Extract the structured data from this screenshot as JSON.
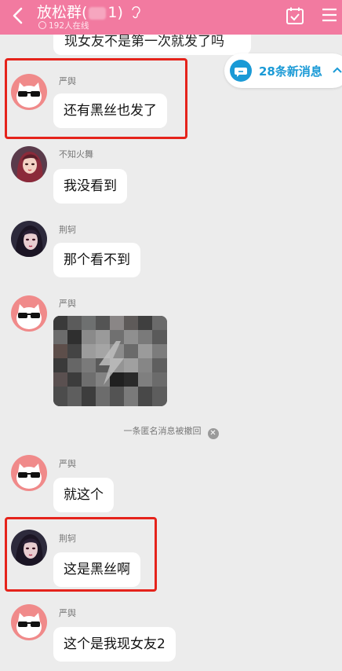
{
  "header": {
    "title_prefix": "放松群(",
    "title_suffix": "1)",
    "online": "192人在线"
  },
  "partial_message": "现女友不是第一次就发了吗",
  "new_messages": "28条新消息",
  "messages": [
    {
      "sender": "严舆",
      "text": "还有黑丝也发了",
      "avatar": "sunglasses-cat"
    },
    {
      "sender": "不知火舞",
      "text": "我没看到",
      "avatar": "anime-girl"
    },
    {
      "sender": "荆轲",
      "text": "那个看不到",
      "avatar": "anime-assassin"
    },
    {
      "sender": "严舆",
      "image": true,
      "avatar": "sunglasses-cat"
    },
    {
      "sender": "严舆",
      "text": "就这个",
      "avatar": "sunglasses-cat"
    },
    {
      "sender": "荆轲",
      "text": "这是黑丝啊",
      "avatar": "anime-assassin"
    },
    {
      "sender": "严舆",
      "text": "这个是我现女友2",
      "avatar": "sunglasses-cat"
    }
  ],
  "recall_notice": "一条匿名消息被撤回",
  "colors": {
    "header_bg": "#f27aa0",
    "highlight_box": "#e5231b",
    "new_msg_text": "#1a9ad6"
  }
}
